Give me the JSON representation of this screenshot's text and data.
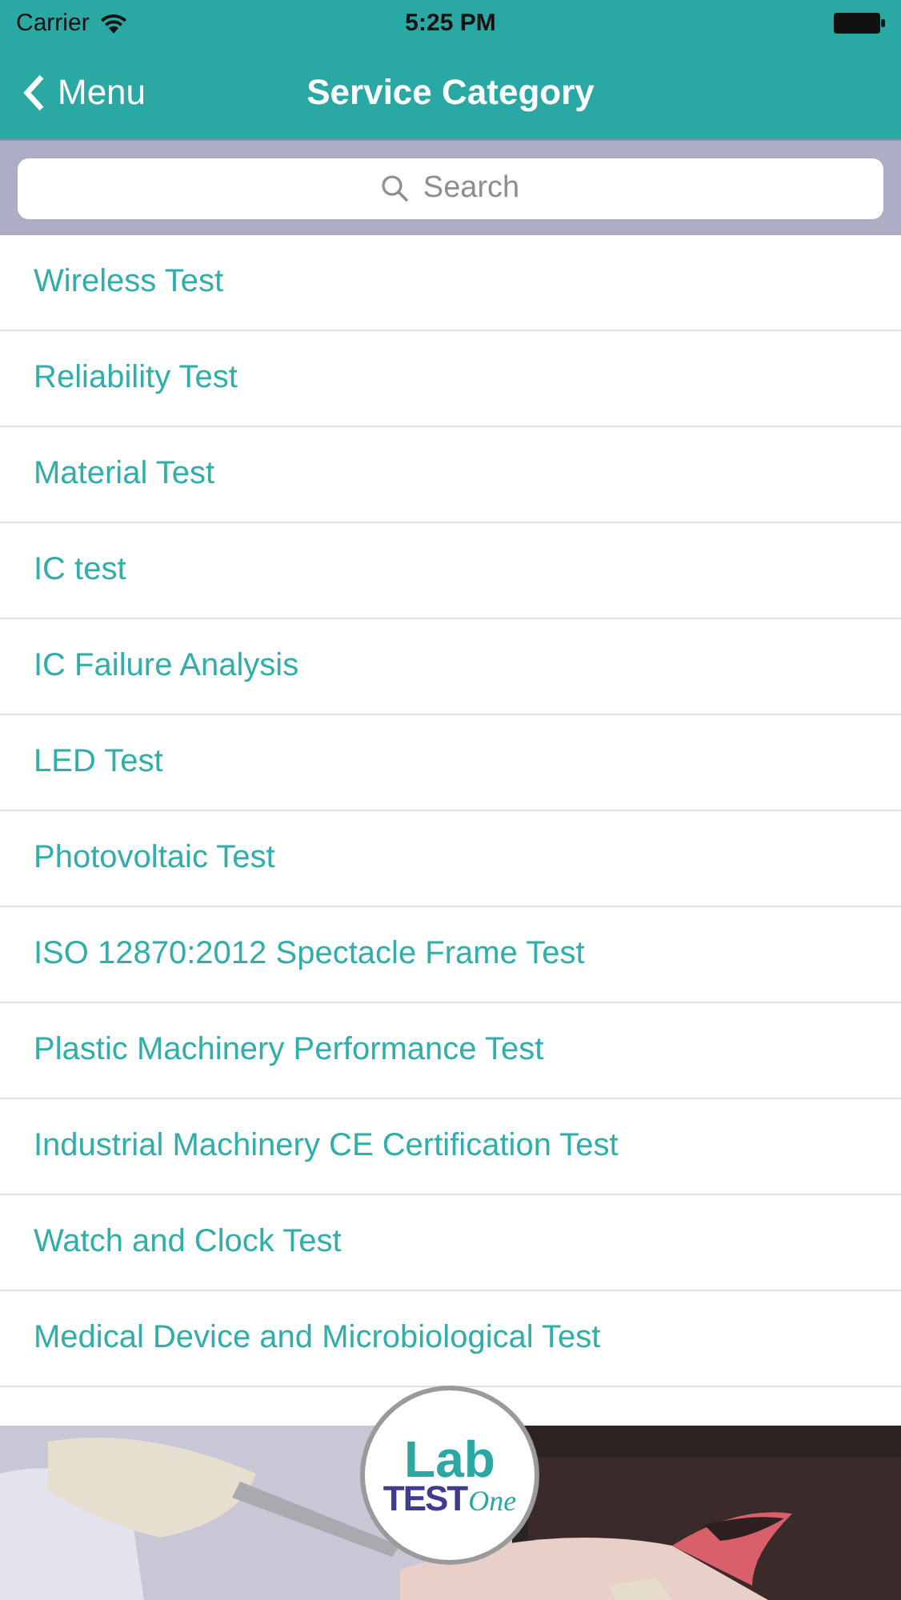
{
  "status_bar": {
    "carrier": "Carrier",
    "time": "5:25 PM"
  },
  "nav": {
    "back": "Menu",
    "title": "Service Category"
  },
  "search": {
    "placeholder": "Search"
  },
  "items": [
    "Wireless Test",
    "Reliability Test",
    "Material Test",
    "IC test",
    "IC Failure Analysis",
    "LED Test",
    "Photovoltaic Test",
    "ISO 12870:2012 Spectacle Frame Test",
    "Plastic Machinery Performance Test",
    "Industrial Machinery CE Certification Test",
    "Watch and Clock Test",
    "Medical Device and Microbiological Test"
  ],
  "banner": {
    "kind": "picture",
    "logo": {
      "line_1": "Lab",
      "line_2": "TEST",
      "line_3": "One"
    }
  }
}
